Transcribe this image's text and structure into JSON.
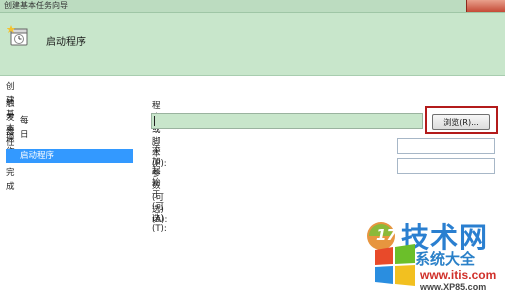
{
  "window": {
    "title": "创建基本任务向导",
    "banner_title": "启动程序"
  },
  "sidebar": {
    "items": [
      {
        "label": "创建基本任务",
        "selected": false
      },
      {
        "label": "触发器",
        "selected": false
      },
      {
        "label": "每日",
        "selected": false
      },
      {
        "label": "操作",
        "selected": false
      },
      {
        "label": "启动程序",
        "selected": true
      },
      {
        "label": "完成",
        "selected": false
      }
    ]
  },
  "form": {
    "program_label": "程序或脚本(P):",
    "program_value": "",
    "browse_label": "浏览(R)...",
    "args_label": "添加参数(可选)(A):",
    "args_value": "",
    "startin_label": "起始于(可选)(T):",
    "startin_value": ""
  },
  "watermark": {
    "logo_number": "17",
    "brand": "技术网",
    "sub": "系统大全",
    "url1": "www.itis.com",
    "url2": "www.XP85.com"
  },
  "colors": {
    "banner": "#c8e6cb",
    "selection": "#3399ff",
    "highlight_frame": "#b31b1b"
  }
}
